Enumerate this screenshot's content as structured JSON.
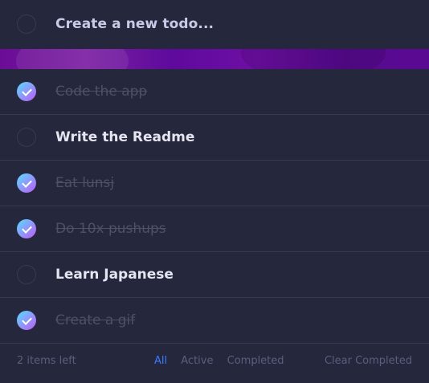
{
  "new_todo": {
    "placeholder": "Create a new todo..."
  },
  "todos": [
    {
      "text": "Code the app",
      "completed": true
    },
    {
      "text": "Write the Readme",
      "completed": false
    },
    {
      "text": "Eat lunsj",
      "completed": true
    },
    {
      "text": "Do 10x pushups",
      "completed": true
    },
    {
      "text": "Learn Japanese",
      "completed": false
    },
    {
      "text": "Create a gif",
      "completed": true
    }
  ],
  "footer": {
    "items_left": "2 items left",
    "filters": [
      {
        "label": "All",
        "active": true
      },
      {
        "label": "Active",
        "active": false
      },
      {
        "label": "Completed",
        "active": false
      }
    ],
    "clear_label": "Clear Completed"
  },
  "colors": {
    "background": "#25273c",
    "accent": "#3a7cfd",
    "check_gradient_start": "#57ddff",
    "check_gradient_end": "#c058f3",
    "banner": "#6a0c96"
  },
  "icons": {
    "check": "check-icon",
    "empty_circle": "circle-icon"
  }
}
